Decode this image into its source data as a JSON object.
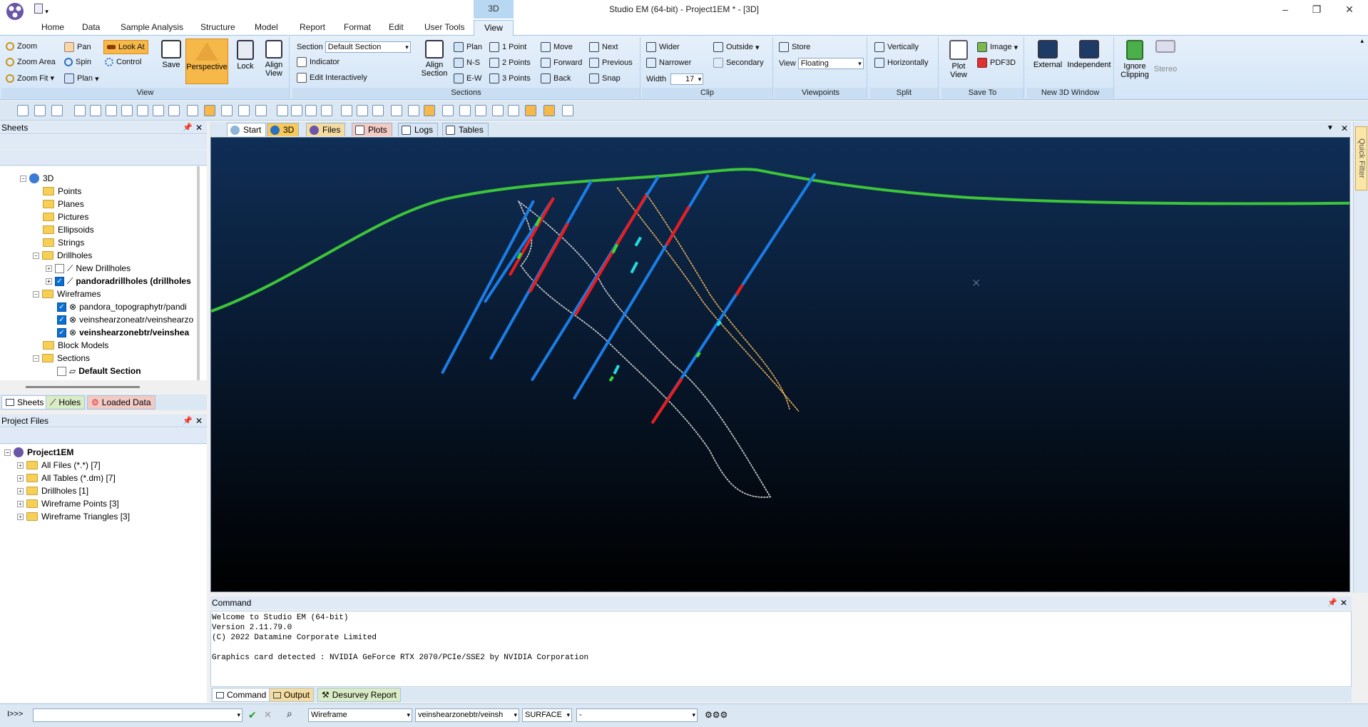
{
  "app": {
    "title": "Studio EM (64-bit) - Project1EM * - [3D]",
    "context_tab": "3D"
  },
  "ribbon_tabs": [
    "Home",
    "Data",
    "Sample Analysis",
    "Structure",
    "Model",
    "Report",
    "Format",
    "Edit",
    "User Tools",
    "View"
  ],
  "ribbon": {
    "view_group": {
      "label": "View",
      "zoom": "Zoom",
      "pan": "Pan",
      "look_at": "Look At",
      "zoom_area": "Zoom Area",
      "spin": "Spin",
      "control": "Control",
      "zoom_fit": "Zoom Fit",
      "plan": "Plan",
      "save": "Save",
      "perspective": "Perspective",
      "lock": "Lock",
      "align_view": "Align View"
    },
    "sections_group": {
      "label": "Sections",
      "section_label": "Section",
      "section_value": "Default Section",
      "indicator": "Indicator",
      "edit_interactively": "Edit Interactively",
      "align_section": "Align Section",
      "plan": "Plan",
      "ns": "N-S",
      "ew": "E-W",
      "one_point": "1 Point",
      "two_points": "2 Points",
      "three_points": "3 Points",
      "move": "Move",
      "forward": "Forward",
      "back": "Back",
      "next": "Next",
      "previous": "Previous",
      "snap": "Snap"
    },
    "clip_group": {
      "label": "Clip",
      "wider": "Wider",
      "narrower": "Narrower",
      "width_label": "Width",
      "width_value": "17",
      "outside": "Outside",
      "secondary": "Secondary"
    },
    "viewpoints_group": {
      "label": "Viewpoints",
      "store": "Store",
      "view_label": "View",
      "view_value": "Floating"
    },
    "split_group": {
      "label": "Split",
      "vertically": "Vertically",
      "horizontally": "Horizontally"
    },
    "saveto_group": {
      "label": "Save To",
      "plot_view": "Plot View",
      "image": "Image",
      "pdf3d": "PDF3D"
    },
    "new3d_group": {
      "label": "New 3D Window",
      "external": "External",
      "independent": "Independent"
    },
    "misc_group": {
      "ignore_clipping": "Ignore Clipping",
      "stereo": "Stereo"
    }
  },
  "sheets_panel": {
    "title": "Sheets",
    "tree": {
      "root": "3D",
      "points": "Points",
      "planes": "Planes",
      "pictures": "Pictures",
      "ellipsoids": "Ellipsoids",
      "strings": "Strings",
      "drillholes": "Drillholes",
      "new_drillholes": "New Drillholes",
      "pandora_drillholes": "pandoradrillholes (drillholes",
      "wireframes": "Wireframes",
      "wf1": "pandora_topographytr/pandi",
      "wf2": "veinshearzoneatr/veinshearzo",
      "wf3": "veinshearzonebtr/veinshea",
      "block_models": "Block Models",
      "sections": "Sections",
      "default_section": "Default Section"
    },
    "tabs": [
      "Sheets",
      "Holes",
      "Loaded Data"
    ]
  },
  "project_panel": {
    "title": "Project Files",
    "root": "Project1EM",
    "items": [
      "All Files (*.*) [7]",
      "All Tables (*.dm) [7]",
      "Drillholes [1]",
      "Wireframe Points [3]",
      "Wireframe Triangles [3]"
    ]
  },
  "doc_tabs": [
    "Start",
    "3D",
    "Files",
    "Plots",
    "Logs",
    "Tables"
  ],
  "quick_filter": "Quick Filter",
  "command_panel": {
    "title": "Command",
    "lines": [
      "Welcome to Studio EM (64-bit)",
      "Version 2.11.79.0",
      "(C) 2022 Datamine Corporate Limited",
      "",
      "Graphics card detected : NVIDIA GeForce RTX 2070/PCIe/SSE2 by NVIDIA Corporation"
    ],
    "tabs": [
      "Command",
      "Output",
      "Desurvey Report"
    ]
  },
  "statusbar": {
    "prompt": "I>>>",
    "object_type": "Wireframe",
    "object_name": "veinshearzonebtr/veinsh",
    "surface": "SURFACE",
    "attribute": "-"
  },
  "colors": {
    "ribbon_bg": "#dbe8f6",
    "highlight": "#f7b84a",
    "viewport_top": "#0f2e56",
    "viewport_bottom": "#000000",
    "topography": "#3cc43a",
    "drillhole": "#1a7ee6",
    "intercept": "#ee1b1b",
    "vein_a": "#f0b65a",
    "vein_b": "#d6d6d6"
  }
}
